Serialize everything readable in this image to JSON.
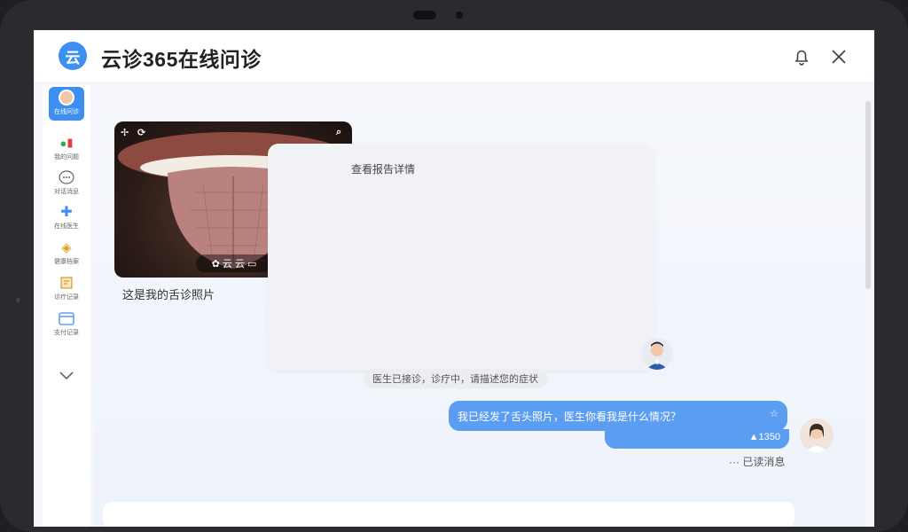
{
  "app": {
    "logo_char": "云",
    "title": "云诊365在线问诊"
  },
  "sidebar": {
    "items": [
      {
        "label": "在线问诊",
        "icon": "doctor-avatar-icon"
      },
      {
        "label": "我的问题",
        "icon": "pill-icon"
      },
      {
        "label": "对话消息",
        "icon": "chat-bubble-icon"
      },
      {
        "label": "在线医生",
        "icon": "medical-cross-icon"
      },
      {
        "label": "健康档案",
        "icon": "folder-icon"
      },
      {
        "label": "诊疗记录",
        "icon": "clipboard-icon"
      },
      {
        "label": "支付记录",
        "icon": "card-icon"
      }
    ]
  },
  "chat": {
    "image_toolbar": "✿ 云 云 ▭",
    "image_caption": "这是我的舌诊照片",
    "doc_card_text": "查看报告详情",
    "system_note": "医生已接诊，诊疗中，请描述您的症状",
    "user_message": "我已经发了舌头照片，医生你看我是什么情况？",
    "bubble_flag": "☆",
    "bubble_count": "▲1350",
    "read_status": "··· 已读消息"
  },
  "colors": {
    "accent": "#3d8ff0",
    "bubble": "#5b9df1",
    "background": "#f4f6fb"
  }
}
